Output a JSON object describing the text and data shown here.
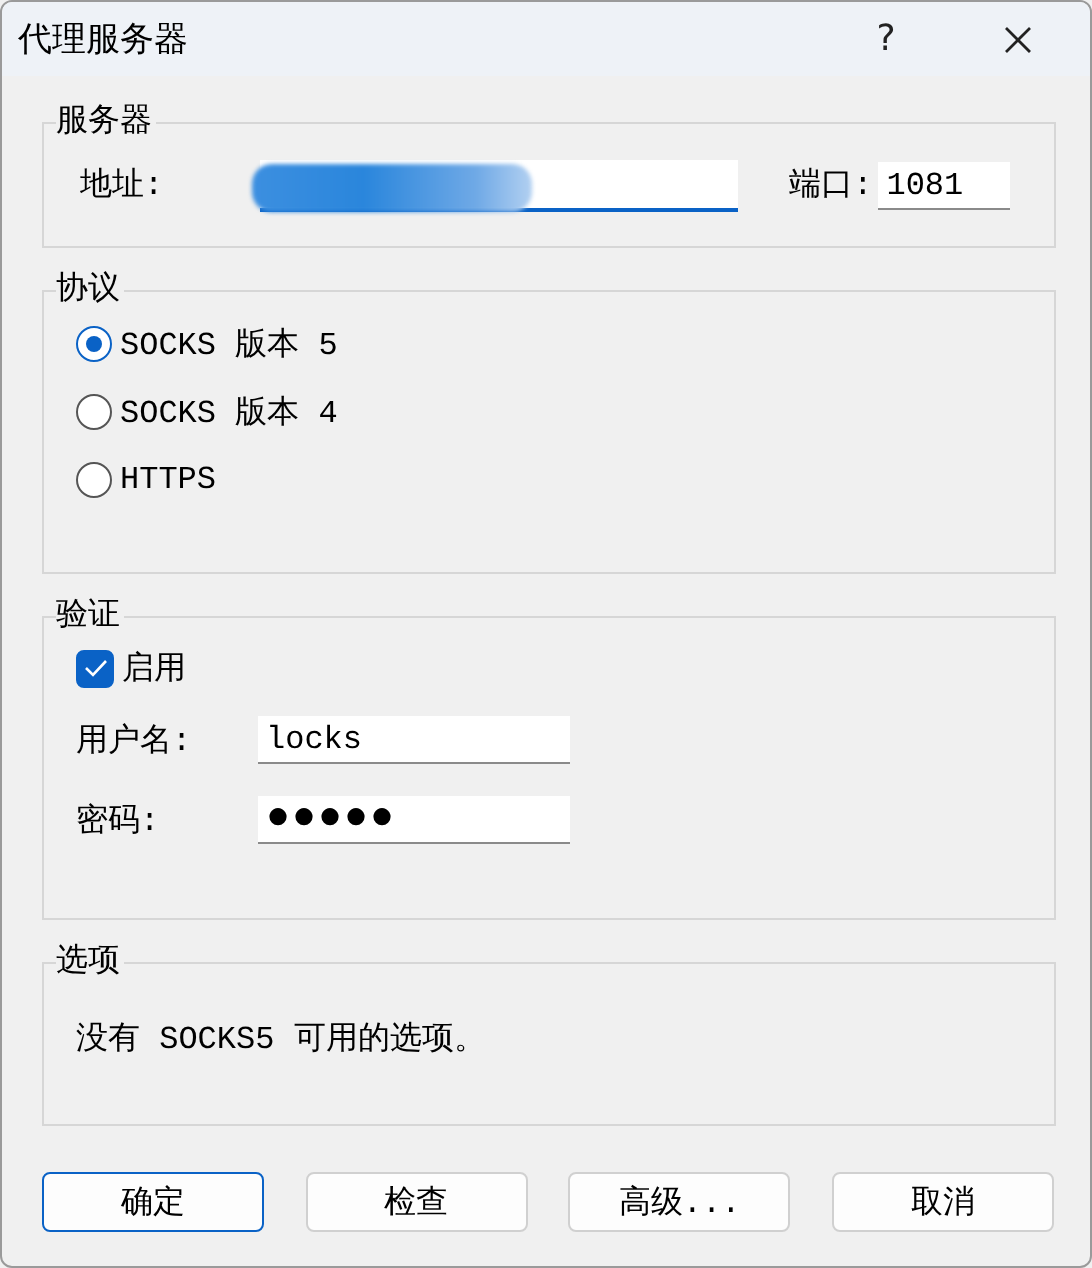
{
  "window": {
    "title": "代理服务器",
    "help": "?"
  },
  "server": {
    "title": "服务器",
    "address": {
      "label": "地址:",
      "redacted": true
    },
    "port": {
      "label": "端口:",
      "value": "1081"
    }
  },
  "protocol": {
    "title": "协议",
    "options": [
      {
        "label": "SOCKS 版本 5",
        "selected": true
      },
      {
        "label": "SOCKS 版本 4",
        "selected": false
      },
      {
        "label": "HTTPS",
        "selected": false
      }
    ]
  },
  "auth": {
    "title": "验证",
    "enable": {
      "label": "启用",
      "checked": true
    },
    "username": {
      "label": "用户名:",
      "value": "locks"
    },
    "password": {
      "label": "密码:",
      "value": "●●●●●"
    }
  },
  "options": {
    "title": "选项",
    "text": "没有 SOCKS5 可用的选项。"
  },
  "buttons": [
    {
      "label": "确定",
      "default": true
    },
    {
      "label": "检查",
      "default": false
    },
    {
      "label": "高级...",
      "default": false
    },
    {
      "label": "取消",
      "default": false
    }
  ]
}
